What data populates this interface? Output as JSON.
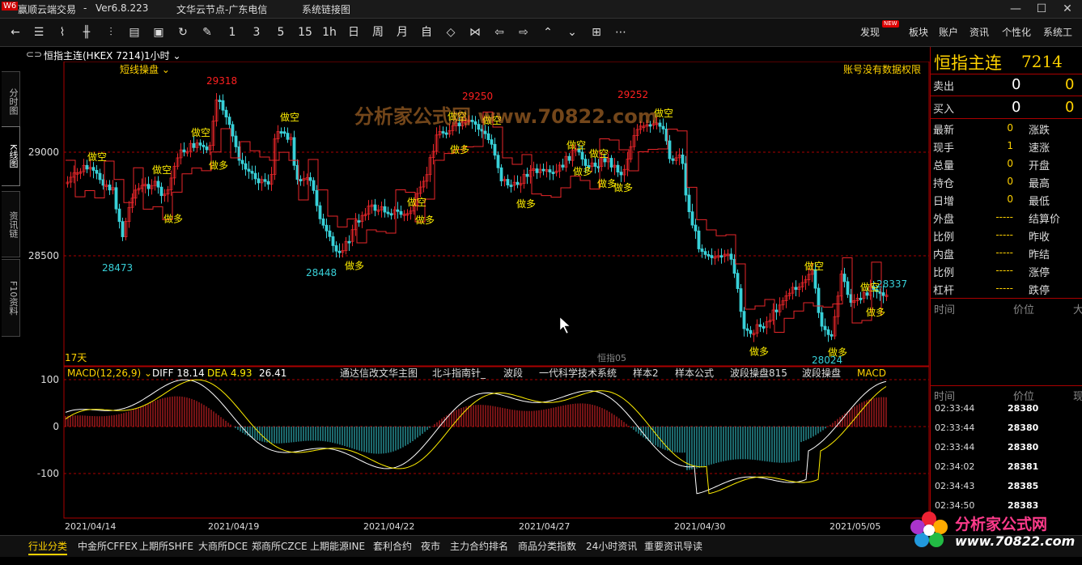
{
  "titlebar": {
    "app_title": "赢顺云端交易",
    "version": "Ver6.8.223",
    "server": "文华云节点-广东电信",
    "system_link": "系统链接图",
    "minimize": "—",
    "maximize": "☐",
    "close": "✕"
  },
  "toolbar": {
    "periods": [
      "1",
      "3",
      "5",
      "15",
      "1h",
      "日",
      "周",
      "月",
      "自"
    ],
    "right_items": [
      "发现",
      "板块",
      "账户",
      "资讯",
      "个性化",
      "系统工"
    ],
    "new_badge": "NEW"
  },
  "left_tabs": [
    "分时图",
    "K线图",
    "资讯链",
    "F10资料"
  ],
  "chart_header": {
    "symbol": "恒指主连(HKEX 7214)",
    "period": "1小时",
    "strategy": "短线操盘",
    "notice": "账号没有数据权限",
    "days_label": "17天",
    "sub_label": "恒指05"
  },
  "indicator_bar": {
    "macd_name": "MACD(12,26,9)",
    "diff": "DIFF 18.14",
    "dea": "DEA 4.93",
    "macd_val": "26.41",
    "formulas": [
      "通达信改文华主图",
      "北斗指南针_",
      "波段",
      "一代科学技术系统",
      "样本2",
      "样本公式",
      "波段操盘815",
      "波段操盘",
      "MACD"
    ]
  },
  "price_axis": [
    "29000",
    "28500"
  ],
  "macd_axis": [
    "100",
    "0",
    "-100"
  ],
  "date_axis": [
    "2021/04/14",
    "2021/04/19",
    "2021/04/22",
    "2021/04/27",
    "2021/04/30",
    "2021/05/05"
  ],
  "annotations": {
    "highs": [
      "29318",
      "29250",
      "29252"
    ],
    "lows": [
      "28473",
      "28448",
      "28024"
    ],
    "last": "28337",
    "short_sig": "做空",
    "long_sig": "做多"
  },
  "watermark": "分析家公式网 www.70822.com",
  "right_panel": {
    "title": "恒指主连",
    "code": "7214",
    "sell_label": "卖出",
    "sell_val": "0",
    "sell_vol": "0",
    "buy_label": "买入",
    "buy_val": "0",
    "buy_vol": "0",
    "stats_left": [
      {
        "label": "最新",
        "value": "0"
      },
      {
        "label": "现手",
        "value": "1"
      },
      {
        "label": "总量",
        "value": "0"
      },
      {
        "label": "持仓",
        "value": "0"
      },
      {
        "label": "日增",
        "value": "0"
      },
      {
        "label": "外盘",
        "value": "-----"
      },
      {
        "label": "比例",
        "value": "-----"
      },
      {
        "label": "内盘",
        "value": "-----"
      },
      {
        "label": "比例",
        "value": "-----"
      },
      {
        "label": "杠杆",
        "value": "-----"
      }
    ],
    "stats_right": [
      "涨跌",
      "速涨",
      "开盘",
      "最高",
      "最低",
      "结算价",
      "昨收",
      "昨结",
      "涨停",
      "跌停"
    ],
    "tick_header": [
      "时间",
      "价位",
      "大"
    ],
    "tick_header2": [
      "时间",
      "价位",
      "现"
    ],
    "ticks": [
      {
        "time": "02:33:44",
        "price": "28380"
      },
      {
        "time": "02:33:44",
        "price": "28380"
      },
      {
        "time": "02:33:44",
        "price": "28380"
      },
      {
        "time": "02:34:02",
        "price": "28381"
      },
      {
        "time": "02:34:43",
        "price": "28385"
      },
      {
        "time": "02:34:50",
        "price": "28383"
      }
    ]
  },
  "bottom_tabs": [
    "行业分类",
    "中金所CFFEX",
    "上期所SHFE",
    "大商所DCE",
    "郑商所CZCE",
    "上期能源INE",
    "套利合约",
    "夜市",
    "主力合约排名",
    "商品分类指数",
    "24小时资讯",
    "重要资讯导读"
  ],
  "logo": {
    "text": "分析家公式网",
    "url": "www.70822.com"
  },
  "colors": {
    "up": "#e8262a",
    "down": "#38d0d8",
    "signal": "#ffee00",
    "accent": "#ffd200"
  }
}
